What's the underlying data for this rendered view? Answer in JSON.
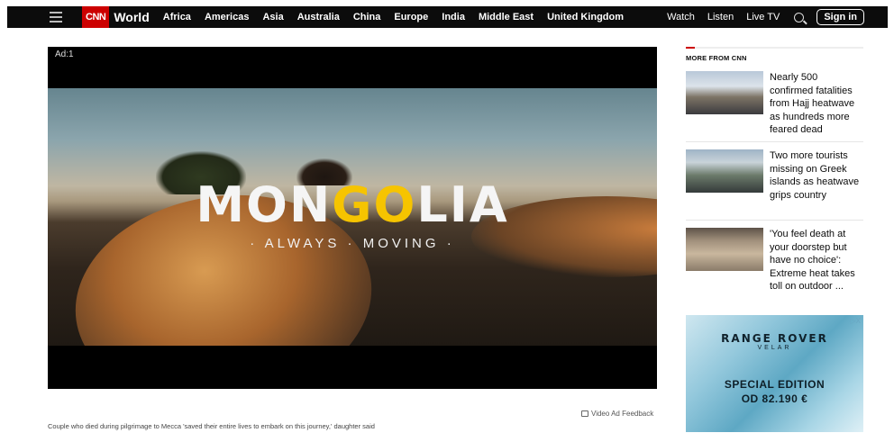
{
  "nav": {
    "logo": "CNN",
    "edition": "World",
    "links": [
      "Africa",
      "Americas",
      "Asia",
      "Australia",
      "China",
      "Europe",
      "India",
      "Middle East",
      "United Kingdom"
    ],
    "right": {
      "watch": "Watch",
      "listen": "Listen",
      "live_tv": "Live TV",
      "sign_in": "Sign in"
    }
  },
  "video": {
    "ad_label": "Ad:1",
    "brand_title_pre": "MON",
    "brand_title_hl": "GO",
    "brand_title_post": "LIA",
    "brand_tagline": "· ALWAYS · MOVING ·",
    "feedback": "Video Ad Feedback",
    "caption": "Couple who died during pilgrimage to Mecca 'saved their entire lives to embark on this journey,' daughter said"
  },
  "sidebar": {
    "heading": "MORE FROM CNN",
    "stories": [
      {
        "text": "Nearly 500 confirmed fatalities from Hajj heatwave as hundreds more feared dead"
      },
      {
        "text": "Two more tourists missing on Greek islands as heatwave grips country"
      },
      {
        "text": "'You feel death at your doorstep but have no choice': Extreme heat takes toll on outdoor ..."
      }
    ]
  },
  "ad": {
    "brand": "RANGE ROVER",
    "sub": "VELAR",
    "line1": "SPECIAL EDITION",
    "line2": "OD 82.190 €",
    "choices": "▷X"
  }
}
